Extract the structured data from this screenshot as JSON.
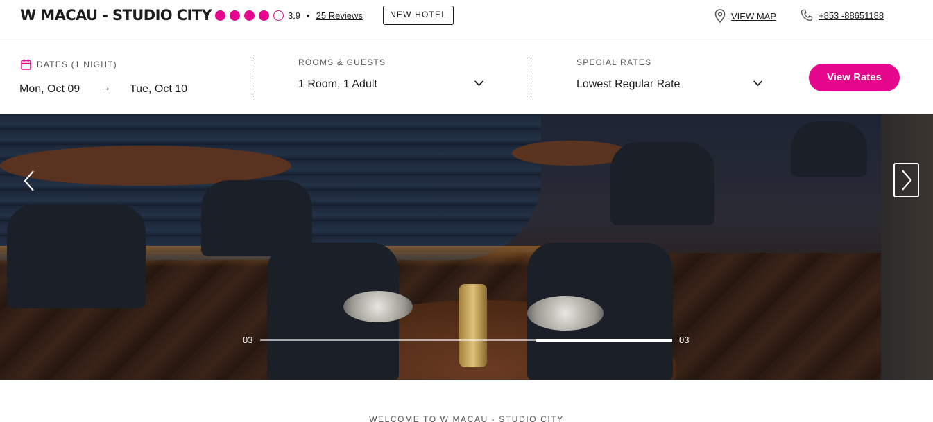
{
  "header": {
    "hotel_name": "W MACAU - STUDIO CITY",
    "rating_value": "3.9",
    "rating_stars": {
      "filled": 4,
      "total": 5
    },
    "bullet": "•",
    "reviews_label": "25 Reviews",
    "badge_label": "NEW HOTEL",
    "map_label": "VIEW MAP",
    "phone_label": "+853 -88651188"
  },
  "booking": {
    "dates_label": "DATES (1 NIGHT)",
    "check_in": "Mon, Oct 09",
    "arrow": "→",
    "check_out": "Tue, Oct 10",
    "rooms_label": "ROOMS & GUESTS",
    "rooms_value": "1 Room, 1 Adult",
    "rates_label": "SPECIAL RATES",
    "rates_value": "Lowest Regular Rate",
    "view_rates_label": "View Rates"
  },
  "carousel": {
    "slide_start": "03",
    "slide_end": "03",
    "progress": 0.33
  },
  "welcome_text": "WELCOME TO W MACAU - STUDIO CITY",
  "colors": {
    "accent": "#e6058d",
    "text": "#1c1c1c"
  },
  "icons": {
    "map": "map-pin-icon",
    "phone": "phone-icon",
    "calendar": "calendar-icon",
    "chevron": "chevron-down-icon",
    "prev": "chevron-left-icon",
    "next": "chevron-right-icon"
  }
}
